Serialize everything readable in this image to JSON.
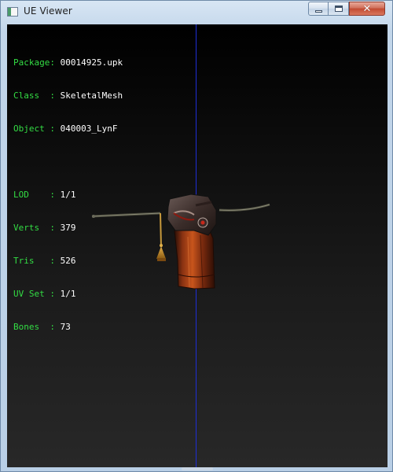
{
  "window": {
    "title": "UE Viewer"
  },
  "title_controls": {
    "minimize": "minimize",
    "maximize": "maximize",
    "close": "close"
  },
  "info": {
    "rows": [
      {
        "label": "Package: ",
        "value": "00014925.upk"
      },
      {
        "label": "Class  : ",
        "value": "SkeletalMesh"
      },
      {
        "label": "Object : ",
        "value": "040003_LynF"
      },
      {
        "label": "LOD    : ",
        "value": "1/1"
      },
      {
        "label": "Verts  : ",
        "value": "379"
      },
      {
        "label": "Tris   : ",
        "value": "526"
      },
      {
        "label": "UV Set : ",
        "value": "1/1"
      },
      {
        "label": "Bones  : ",
        "value": "73"
      }
    ]
  },
  "colors": {
    "label_green": "#33dd44",
    "value_white": "#ffffff",
    "axis_blue": "#1e2ed6",
    "viewport_top": "#000000",
    "viewport_bottom": "#282828"
  },
  "icons": {
    "app": "app-window-icon",
    "minimize": "minimize-icon",
    "maximize": "maximize-icon",
    "close": "close-icon"
  }
}
